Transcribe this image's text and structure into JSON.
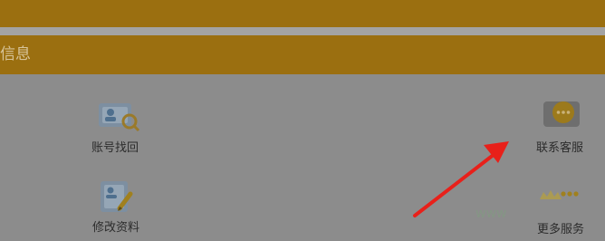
{
  "section": {
    "title": "信息"
  },
  "services": [
    {
      "label": "账号找回",
      "icon": "account-recovery-icon"
    },
    {
      "label": "联系客服",
      "icon": "chat-bubble-icon"
    },
    {
      "label": "修改资料",
      "icon": "edit-profile-icon"
    },
    {
      "label": "更多服务",
      "icon": "more-dots-icon"
    }
  ],
  "annotation": {
    "arrow": "red-arrow",
    "color": "#e8201a"
  },
  "colors": {
    "header": "#9b6f10",
    "panel": "#8c8c8c"
  }
}
